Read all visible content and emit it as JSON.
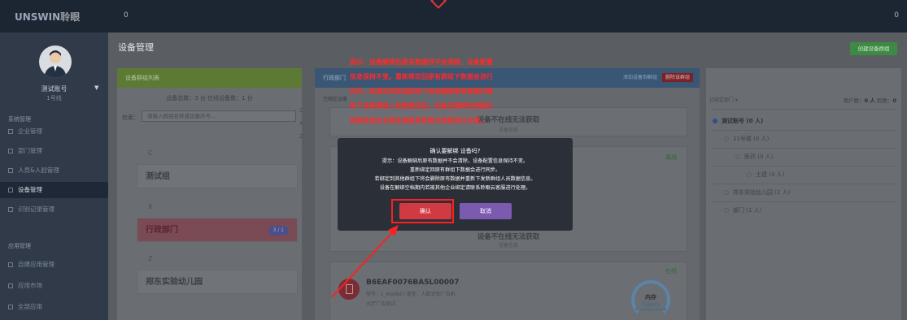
{
  "topbar": {
    "logo_en": "UNSWIN",
    "logo_zh": "聆眼",
    "left_counter": "0",
    "right_counter": "0"
  },
  "sidebar": {
    "user_name": "测试账号",
    "user_sub": "1号线",
    "sections": [
      {
        "title": "系统管理"
      },
      {
        "title": "应用管理"
      }
    ],
    "items": [
      {
        "label": "企业管理"
      },
      {
        "label": "部门管理"
      },
      {
        "label": "人员&人脸管理"
      },
      {
        "label": "设备管理"
      },
      {
        "label": "识别记录管理"
      },
      {
        "label": "自建应用管理"
      },
      {
        "label": "应用市场"
      },
      {
        "label": "全部应用"
      }
    ]
  },
  "main": {
    "page_title": "设备管理",
    "create_button": "创建设备群组",
    "groups_panel": {
      "header": "设备群组列表",
      "stats": "设备总数：3 台  在线设备数：1 台",
      "search_label": "检索：",
      "search_placeholder": "请输入群组名称或设备序号...",
      "groups": [
        {
          "letter": "C",
          "name": "测试组",
          "count": ""
        },
        {
          "letter": "X",
          "name": "行政部门",
          "count": "3 / 1"
        },
        {
          "letter": "Z",
          "name": "郑东实验幼儿园",
          "count": ""
        }
      ],
      "alphabet": [
        "C",
        "X",
        "Z"
      ]
    },
    "devices_panel": {
      "header": "行政部门",
      "actions": {
        "add": "添加设备到群组",
        "delete": "删除该群组"
      },
      "sub": "已绑定设备",
      "card1": {
        "title": "设备不在线无法获取",
        "sub": "设备信息"
      },
      "card2": {
        "title": "设备不在线无法获取",
        "sub": "设备信息",
        "status": "离线"
      },
      "card3": {
        "status": "在线",
        "device_id": "B6EAF0076BA5L00007",
        "meta": "型号：L_AiotAd | 类型：人脸识别广告机",
        "meta2": "大厅广告测试",
        "storage_label": "内存",
        "storage_pct": "可用89%",
        "storage_size": "4.15GB/4.65GB"
      }
    },
    "people_panel": {
      "filter": "已绑定部门 ▾",
      "users_label": "用户数：",
      "users_value": "0 人",
      "faces_label": "脸数：",
      "faces_value": "0",
      "tree": [
        {
          "label": "测试账号 (0 人)"
        },
        {
          "label": "11号楼 (0 人)"
        },
        {
          "label": "医药 (0 人)"
        },
        {
          "label": "土建 (4 人)"
        },
        {
          "label": "郑东实验幼儿园 (2 人)"
        },
        {
          "label": "部门 (1 人)"
        }
      ]
    }
  },
  "tip": {
    "lines": [
      "提示：设备解绑后原有数据并不会清除，设备配置",
      "信息保持不变。重新绑定回原有群组下数据会进行",
      "同步。若绑定到其他群组下将会删除原有数据并重",
      "新下发新群组人员数据信息。设备在解绑空档期内",
      "若被其他企业绑定请联系聆眼云客服进行处理。"
    ]
  },
  "modal": {
    "title": "确认要解绑 设备吗?",
    "lines": [
      "提示：设备解绑后原有数据并不会清除，设备配置信息保持不变。",
      "重新绑定回原有群组下数据会进行同步。",
      "若绑定到其他群组下将会删除原有数据并重新下发新群组人员数据信息。",
      "设备在解绑空档期内若被其他企业绑定请联系聆眼云客服进行处理。"
    ],
    "confirm": "确认",
    "cancel": "取消"
  },
  "colors": {
    "confirm": "#d23a43",
    "cancel": "#7c5ab0",
    "annotation": "#ff1f1f"
  }
}
